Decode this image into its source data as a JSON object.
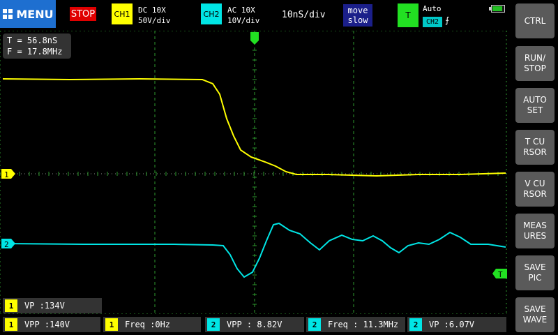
{
  "topbar": {
    "menu_label": "MENU",
    "run_state": "STOP",
    "ch1": {
      "badge": "CH1",
      "coupling": "DC 10X",
      "scale": "50V/div"
    },
    "ch2": {
      "badge": "CH2",
      "coupling": "AC 10X",
      "scale": "10V/div"
    },
    "timebase": "10nS/div",
    "move_line1": "move",
    "move_line2": "slow",
    "trigger": {
      "badge": "T",
      "mode": "Auto",
      "source": "CH2",
      "edge_symbol": "⨍"
    }
  },
  "cursor_readout": {
    "period": "T = 56.8nS",
    "freq": "F = 17.8MHz"
  },
  "markers": {
    "ch1": "1",
    "ch2": "2",
    "trigger": "T"
  },
  "side_buttons": [
    {
      "label": "CTRL"
    },
    {
      "label": "RUN/\nSTOP"
    },
    {
      "label": "AUTO\nSET"
    },
    {
      "label": "T CU\nRSOR"
    },
    {
      "label": "V CU\nRSOR"
    },
    {
      "label": "MEAS\nURES"
    },
    {
      "label": "SAVE\nPIC"
    },
    {
      "label": "SAVE\nWAVE"
    }
  ],
  "measurements": [
    {
      "ch": "1",
      "text": "VP  :134V"
    },
    {
      "ch": "1",
      "text": "VPP :140V"
    },
    {
      "ch": "1",
      "text": "Freq :0Hz"
    },
    {
      "ch": "2",
      "text": "VPP  : 8.82V"
    },
    {
      "ch": "2",
      "text": "Freq : 11.3MHz"
    },
    {
      "ch": "2",
      "text": "VP   :6.07V"
    }
  ],
  "colors": {
    "ch1": "#ffff00",
    "ch2": "#00e5e5",
    "grid": "#2a8f2a",
    "trigger": "#22e022"
  }
}
